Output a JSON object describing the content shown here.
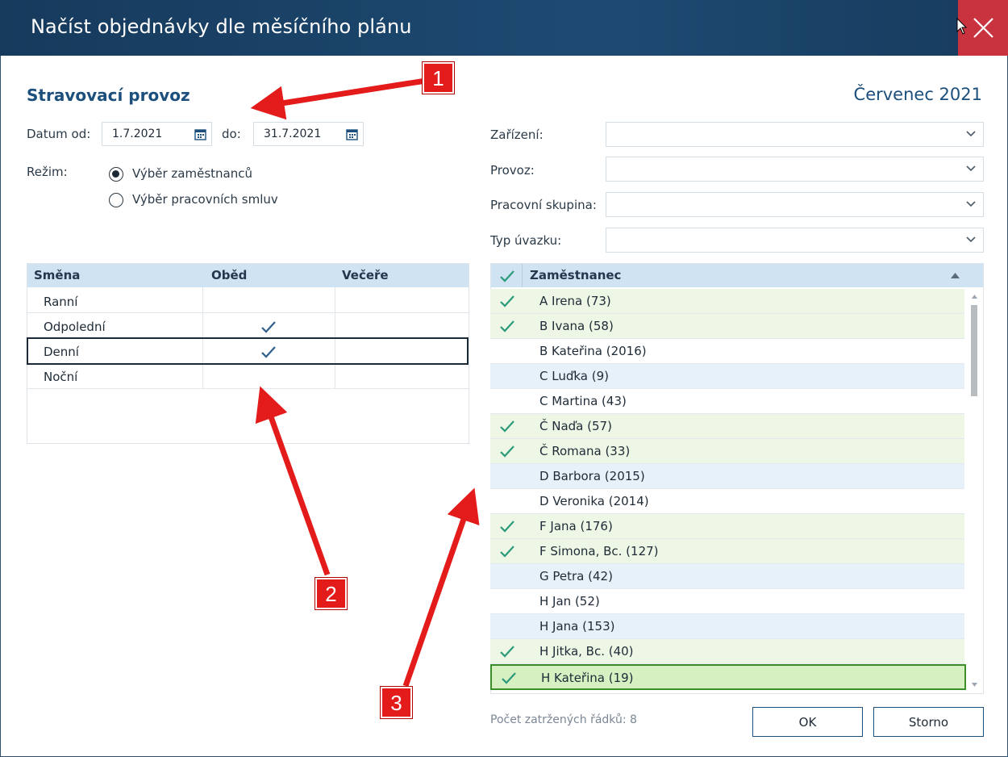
{
  "window": {
    "title": "Načíst objednávky dle měsíčního plánu"
  },
  "header": {
    "section": "Stravovací provoz",
    "month": "Červenec 2021"
  },
  "dates": {
    "from_label": "Datum od:",
    "from_value": "1.7.2021",
    "to_label": "do:",
    "to_value": "31.7.2021"
  },
  "mode": {
    "label": "Režim:",
    "options": [
      {
        "label": "Výběr zaměstnanců",
        "selected": true
      },
      {
        "label": "Výběr pracovních smluv",
        "selected": false
      }
    ]
  },
  "filters": [
    {
      "label": "Zařízení:",
      "value": ""
    },
    {
      "label": "Provoz:",
      "value": ""
    },
    {
      "label": "Pracovní skupina:",
      "value": ""
    },
    {
      "label": "Typ úvazku:",
      "value": ""
    }
  ],
  "shifts": {
    "columns": [
      "Směna",
      "Oběd",
      "Večeře"
    ],
    "rows": [
      {
        "name": "Ranní",
        "obed": false,
        "vecere": false
      },
      {
        "name": "Odpolední",
        "obed": true,
        "vecere": false
      },
      {
        "name": "Denní",
        "obed": true,
        "vecere": false,
        "focused": true
      },
      {
        "name": "Noční",
        "obed": false,
        "vecere": false
      }
    ]
  },
  "employees": {
    "column": "Zaměstnanec",
    "rows": [
      {
        "name": "A Irena (73)",
        "checked": true
      },
      {
        "name": "B Ivana (58)",
        "checked": true
      },
      {
        "name": "B Kateřina (2016)",
        "checked": false
      },
      {
        "name": "C Luďka (9)",
        "checked": false
      },
      {
        "name": "C Martina (43)",
        "checked": false
      },
      {
        "name": "Č Naďa (57)",
        "checked": true
      },
      {
        "name": "Č Romana (33)",
        "checked": true
      },
      {
        "name": "D Barbora (2015)",
        "checked": false
      },
      {
        "name": "D Veronika (2014)",
        "checked": false
      },
      {
        "name": "F Jana (176)",
        "checked": true
      },
      {
        "name": "F Simona, Bc. (127)",
        "checked": true
      },
      {
        "name": "G Petra (42)",
        "checked": false
      },
      {
        "name": "H Jan (52)",
        "checked": false
      },
      {
        "name": "H Jana (153)",
        "checked": false
      },
      {
        "name": "H Jitka, Bc. (40)",
        "checked": true
      },
      {
        "name": "H Kateřina (19)",
        "checked": true,
        "selected": true
      }
    ]
  },
  "footer": {
    "count": "Počet zatržených řádků: 8",
    "ok": "OK",
    "cancel": "Storno"
  },
  "annotations": {
    "badge1": "1",
    "badge2": "2",
    "badge3": "3"
  },
  "colors": {
    "titlebar": "#1e4a72",
    "close": "#c9333f",
    "accent": "#1c4f7c",
    "check": "#2a9a7a",
    "annotation": "#e31b1b"
  }
}
